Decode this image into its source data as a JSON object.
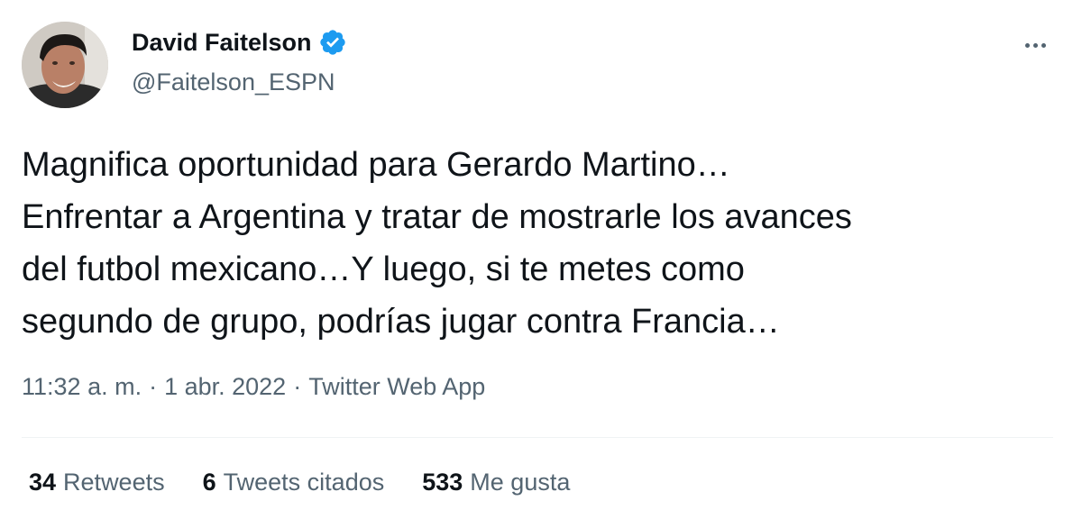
{
  "author": {
    "name": "David Faitelson",
    "handle": "@Faitelson_ESPN",
    "verified_icon": "verified-badge-icon",
    "verified_color": "#1d9bf0"
  },
  "more_icon": "more-horizontal-icon",
  "tweet": {
    "lines": [
      "Magnifica oportunidad para Gerardo Martino…",
      "Enfrentar a Argentina y tratar de mostrarle los avances",
      "del futbol mexicano…Y luego, si te metes como",
      "segundo de grupo, podrías jugar contra Francia…"
    ]
  },
  "meta": {
    "time": "11:32 a. m.",
    "separator": "·",
    "date": "1 abr. 2022",
    "source": "Twitter Web App"
  },
  "stats": {
    "retweets_count": "34",
    "retweets_label": "Retweets",
    "quotes_count": "6",
    "quotes_label": "Tweets citados",
    "likes_count": "533",
    "likes_label": "Me gusta"
  },
  "colors": {
    "text": "#0f1419",
    "secondary": "#536471",
    "divider": "#eff3f4"
  }
}
